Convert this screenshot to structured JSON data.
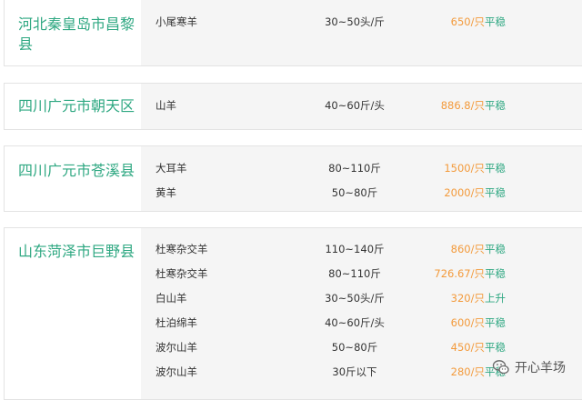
{
  "listings": [
    {
      "region": "河北秦皇岛市昌黎县",
      "rows": [
        {
          "breed": "小尾寒羊",
          "spec": "30~50头/斤",
          "price": "650/只",
          "trend": "平稳"
        }
      ]
    },
    {
      "region": "四川广元市朝天区",
      "rows": [
        {
          "breed": "山羊",
          "spec": "40~60斤/头",
          "price": "886.8/只",
          "trend": "平稳"
        }
      ]
    },
    {
      "region": "四川广元市苍溪县",
      "rows": [
        {
          "breed": "大耳羊",
          "spec": "80~110斤",
          "price": "1500/只",
          "trend": "平稳"
        },
        {
          "breed": "黄羊",
          "spec": "50~80斤",
          "price": "2000/只",
          "trend": "平稳"
        }
      ]
    },
    {
      "region": "山东菏泽市巨野县",
      "rows": [
        {
          "breed": "杜寒杂交羊",
          "spec": "110~140斤",
          "price": "860/只",
          "trend": "平稳"
        },
        {
          "breed": "杜寒杂交羊",
          "spec": "80~110斤",
          "price": "726.67/只",
          "trend": "平稳"
        },
        {
          "breed": "白山羊",
          "spec": "30~50头/斤",
          "price": "320/只",
          "trend": "上升"
        },
        {
          "breed": "杜泊绵羊",
          "spec": "40~60斤/头",
          "price": "600/只",
          "trend": "平稳"
        },
        {
          "breed": "波尔山羊",
          "spec": "50~80斤",
          "price": "450/只",
          "trend": "平稳"
        },
        {
          "breed": "波尔山羊",
          "spec": "30斤以下",
          "price": "280/只",
          "trend": "平稳"
        }
      ]
    }
  ],
  "watermark": {
    "text": "开心羊场",
    "icon": "wechat-icon"
  },
  "colors": {
    "region": "#2fa882",
    "price": "#f39a3b",
    "trend": "#2fa882",
    "row_bg": "#f5f5f5"
  }
}
